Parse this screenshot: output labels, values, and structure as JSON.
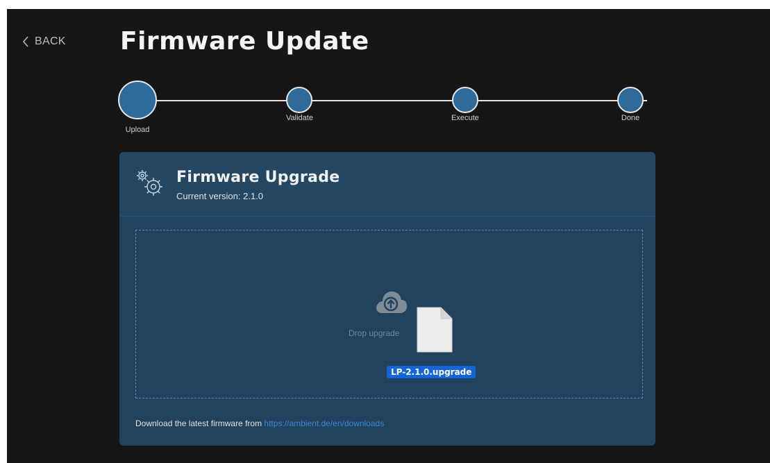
{
  "nav": {
    "back_label": "BACK"
  },
  "page": {
    "title": "Firmware Update"
  },
  "stepper": {
    "steps": [
      {
        "label": "Upload",
        "active": true
      },
      {
        "label": "Validate",
        "active": false
      },
      {
        "label": "Execute",
        "active": false
      },
      {
        "label": "Done",
        "active": false
      }
    ]
  },
  "card": {
    "title": "Firmware Upgrade",
    "subtitle": "Current version: 2.1.0",
    "icon": "gears-icon"
  },
  "dropzone": {
    "text": "Drop upgrade",
    "icon": "cloud-upload-icon",
    "dragged_file": {
      "name": "LP-2.1.0.upgrade",
      "icon": "file-icon"
    }
  },
  "footer": {
    "text": "Download the latest firmware from",
    "link": "https://ambient.de/en/downloads"
  },
  "colors": {
    "background": "#161616",
    "card": "#22425d",
    "step": "#2e6a9a",
    "link": "#3d8ad6",
    "file_label": "#1565d8"
  }
}
